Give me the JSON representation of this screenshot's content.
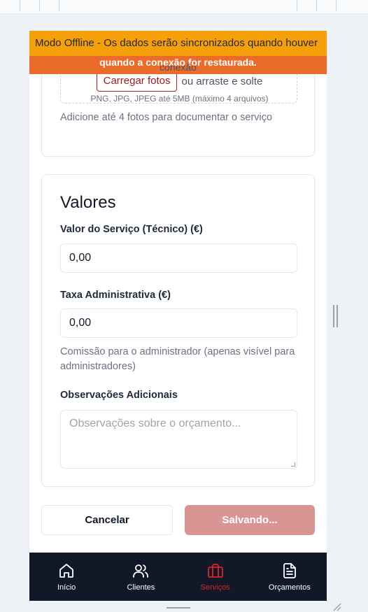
{
  "offline_banner": {
    "line1": "Modo Offline - Os dados serão sincronizados quando houver",
    "line2": "quando a conexão for restaurada.",
    "overflow": "conexão"
  },
  "upload": {
    "button_label": "Carregar fotos",
    "or_text": "ou arraste e solte",
    "types_text": "PNG, JPG, JPEG até 5MB (máximo 4 arquivos)",
    "help_text": "Adicione até 4 fotos para documentar o serviço"
  },
  "values": {
    "title": "Valores",
    "service_label": "Valor do Serviço (Técnico) (€)",
    "service_value": "0,00",
    "admin_fee_label": "Taxa Administrativa (€)",
    "admin_fee_value": "0,00",
    "admin_fee_hint": "Comissão para o administrador (apenas visível para administradores)",
    "notes_label": "Observações Adicionais",
    "notes_placeholder": "Observações sobre o orçamento..."
  },
  "actions": {
    "cancel_label": "Cancelar",
    "save_label": "Salvando..."
  },
  "nav": {
    "items": [
      {
        "label": "Início",
        "icon": "home-icon",
        "active": false
      },
      {
        "label": "Clientes",
        "icon": "users-icon",
        "active": false
      },
      {
        "label": "Serviços",
        "icon": "briefcase-icon",
        "active": true
      },
      {
        "label": "Orçamentos",
        "icon": "document-icon",
        "active": false
      }
    ]
  },
  "colors": {
    "primary": "#dc2626",
    "banner_warning": "#f59f0b",
    "banner_alert": "#ea6b2a",
    "nav_background": "#111827",
    "save_disabled": "#d99494"
  }
}
